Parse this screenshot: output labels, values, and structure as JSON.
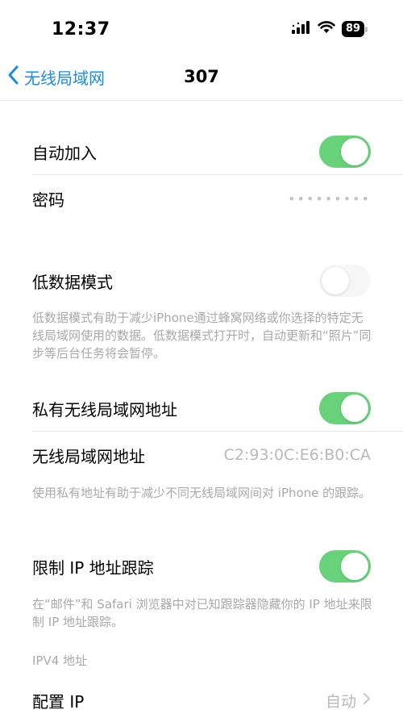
{
  "status_bar": {
    "time": "12:37",
    "battery": "89",
    "icons": [
      "signal-icon",
      "wifi-icon",
      "battery-icon"
    ]
  },
  "nav": {
    "back_label": "无线局域网",
    "title": "307",
    "accent_color": "#1b8ce0"
  },
  "settings": {
    "auto_join": {
      "label": "自动加入",
      "state": "on"
    },
    "password": {
      "label": "密码",
      "value": "•••••••••"
    },
    "low_data_mode": {
      "label": "低数据模式",
      "state": "off",
      "footnote": "低数据模式有助于减少iPhone通过蜂窝网络或你选择的特定无线局域网使用的数据。低数据模式打开时，自动更新和“照片”同步等后台任务将会暂停。"
    },
    "private_address": {
      "label": "私有无线局域网地址",
      "state": "on"
    },
    "wifi_address": {
      "label": "无线局域网地址",
      "value": "C2:93:0C:E6:B0:CA",
      "footnote": "使用私有地址有助于减少不同无线局域网间对 iPhone 的跟踪。"
    },
    "limit_ip_tracking": {
      "label": "限制 IP 地址跟踪",
      "state": "on",
      "footnote": "在“邮件”和 Safari 浏览器中对已知跟踪器隐藏你的 IP 地址来限制 IP 地址跟踪。"
    },
    "ipv4_header": "IPV4 地址",
    "configure_ip": {
      "label": "配置 IP",
      "value": "自动"
    }
  },
  "colors": {
    "toggle_on": "#67d27a",
    "footnote": "#a9a9ae"
  }
}
